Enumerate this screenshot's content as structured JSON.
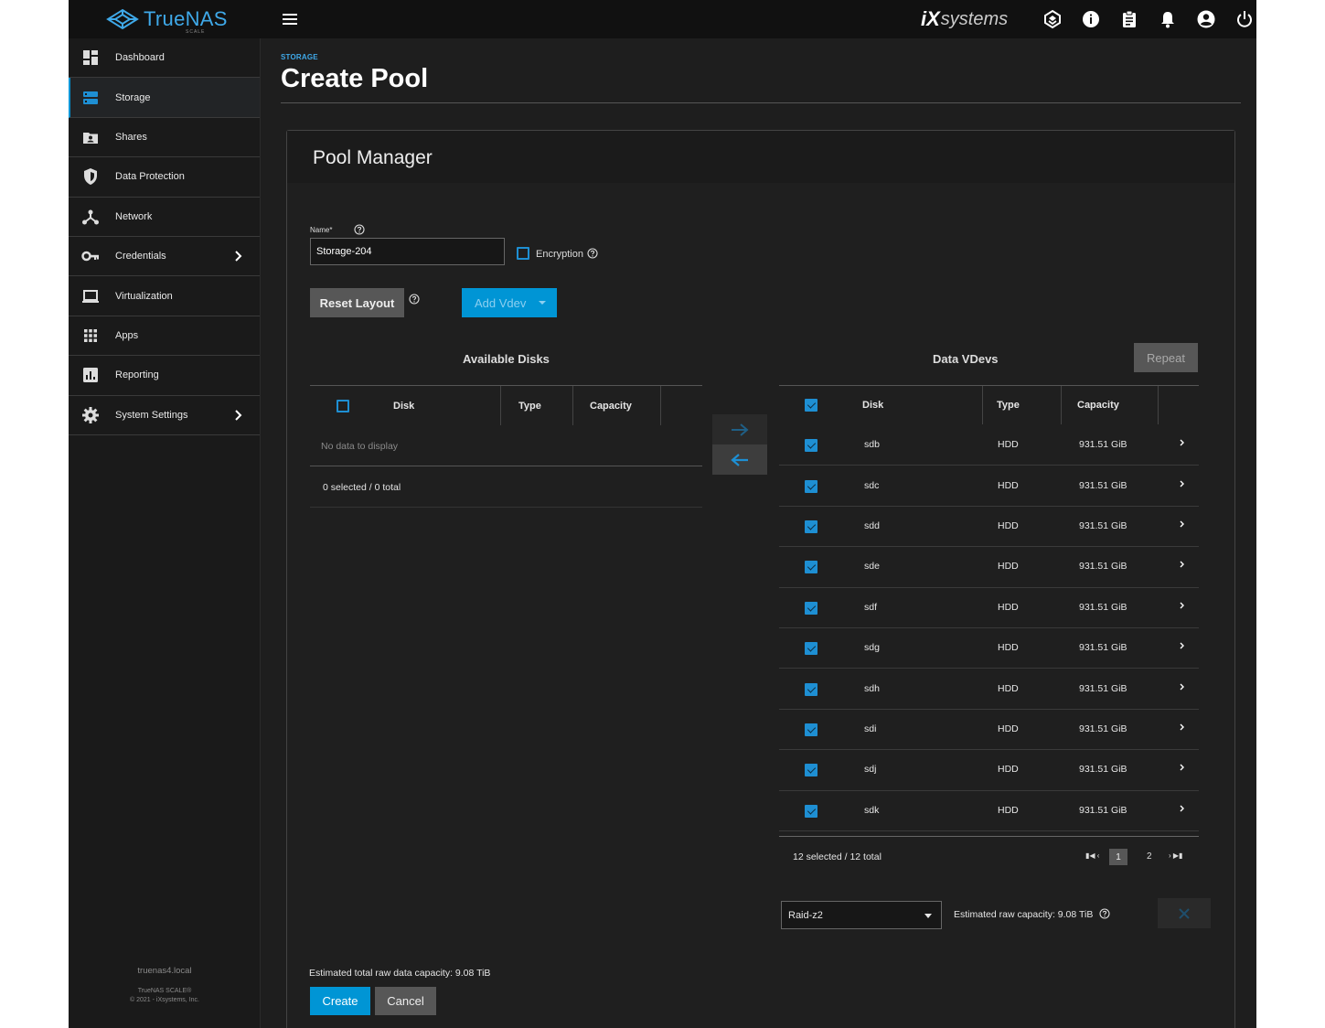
{
  "header": {
    "brand": "TrueNAS",
    "brand_sub": "SCALE",
    "vendor_mark": "iX",
    "vendor_text": "systems"
  },
  "sidebar": {
    "items": [
      {
        "label": "Dashboard",
        "icon": "dashboard-icon"
      },
      {
        "label": "Storage",
        "icon": "storage-icon",
        "active": true
      },
      {
        "label": "Shares",
        "icon": "shares-icon"
      },
      {
        "label": "Data Protection",
        "icon": "shield-icon"
      },
      {
        "label": "Network",
        "icon": "network-icon"
      },
      {
        "label": "Credentials",
        "icon": "key-icon",
        "has_children": true
      },
      {
        "label": "Virtualization",
        "icon": "laptop-icon"
      },
      {
        "label": "Apps",
        "icon": "apps-grid-icon"
      },
      {
        "label": "Reporting",
        "icon": "reporting-icon"
      },
      {
        "label": "System Settings",
        "icon": "gear-icon",
        "has_children": true
      }
    ],
    "hostname": "truenas4.local",
    "version": "TrueNAS SCALE®",
    "copyright": "© 2021 - iXsystems, Inc."
  },
  "page": {
    "breadcrumb": "STORAGE",
    "title": "Create Pool"
  },
  "pool_manager": {
    "title": "Pool Manager",
    "name_label": "Name*",
    "name_value": "Storage-204",
    "encryption_label": "Encryption",
    "encryption_checked": false,
    "reset_layout_label": "Reset Layout",
    "add_vdev_label": "Add Vdev",
    "available": {
      "title": "Available Disks",
      "columns": [
        "Disk",
        "Type",
        "Capacity"
      ],
      "empty_text": "No data to display",
      "footer": "0 selected / 0 total"
    },
    "vdevs": {
      "title": "Data VDevs",
      "repeat_label": "Repeat",
      "columns": [
        "Disk",
        "Type",
        "Capacity"
      ],
      "rows": [
        {
          "disk": "sdb",
          "type": "HDD",
          "capacity": "931.51 GiB"
        },
        {
          "disk": "sdc",
          "type": "HDD",
          "capacity": "931.51 GiB"
        },
        {
          "disk": "sdd",
          "type": "HDD",
          "capacity": "931.51 GiB"
        },
        {
          "disk": "sde",
          "type": "HDD",
          "capacity": "931.51 GiB"
        },
        {
          "disk": "sdf",
          "type": "HDD",
          "capacity": "931.51 GiB"
        },
        {
          "disk": "sdg",
          "type": "HDD",
          "capacity": "931.51 GiB"
        },
        {
          "disk": "sdh",
          "type": "HDD",
          "capacity": "931.51 GiB"
        },
        {
          "disk": "sdi",
          "type": "HDD",
          "capacity": "931.51 GiB"
        },
        {
          "disk": "sdj",
          "type": "HDD",
          "capacity": "931.51 GiB"
        },
        {
          "disk": "sdk",
          "type": "HDD",
          "capacity": "931.51 GiB"
        }
      ],
      "footer": "12 selected / 12 total",
      "pages": [
        "1",
        "2"
      ],
      "current_page": "1",
      "layout_value": "Raid-z2",
      "estimated_raw": "Estimated raw capacity: 9.08 TiB"
    },
    "estimated_total": "Estimated total raw data capacity: 9.08 TiB",
    "create_label": "Create",
    "cancel_label": "Cancel"
  },
  "colors": {
    "accent": "#0095d5",
    "background": "#1e1e1e",
    "topbar": "#111111"
  }
}
